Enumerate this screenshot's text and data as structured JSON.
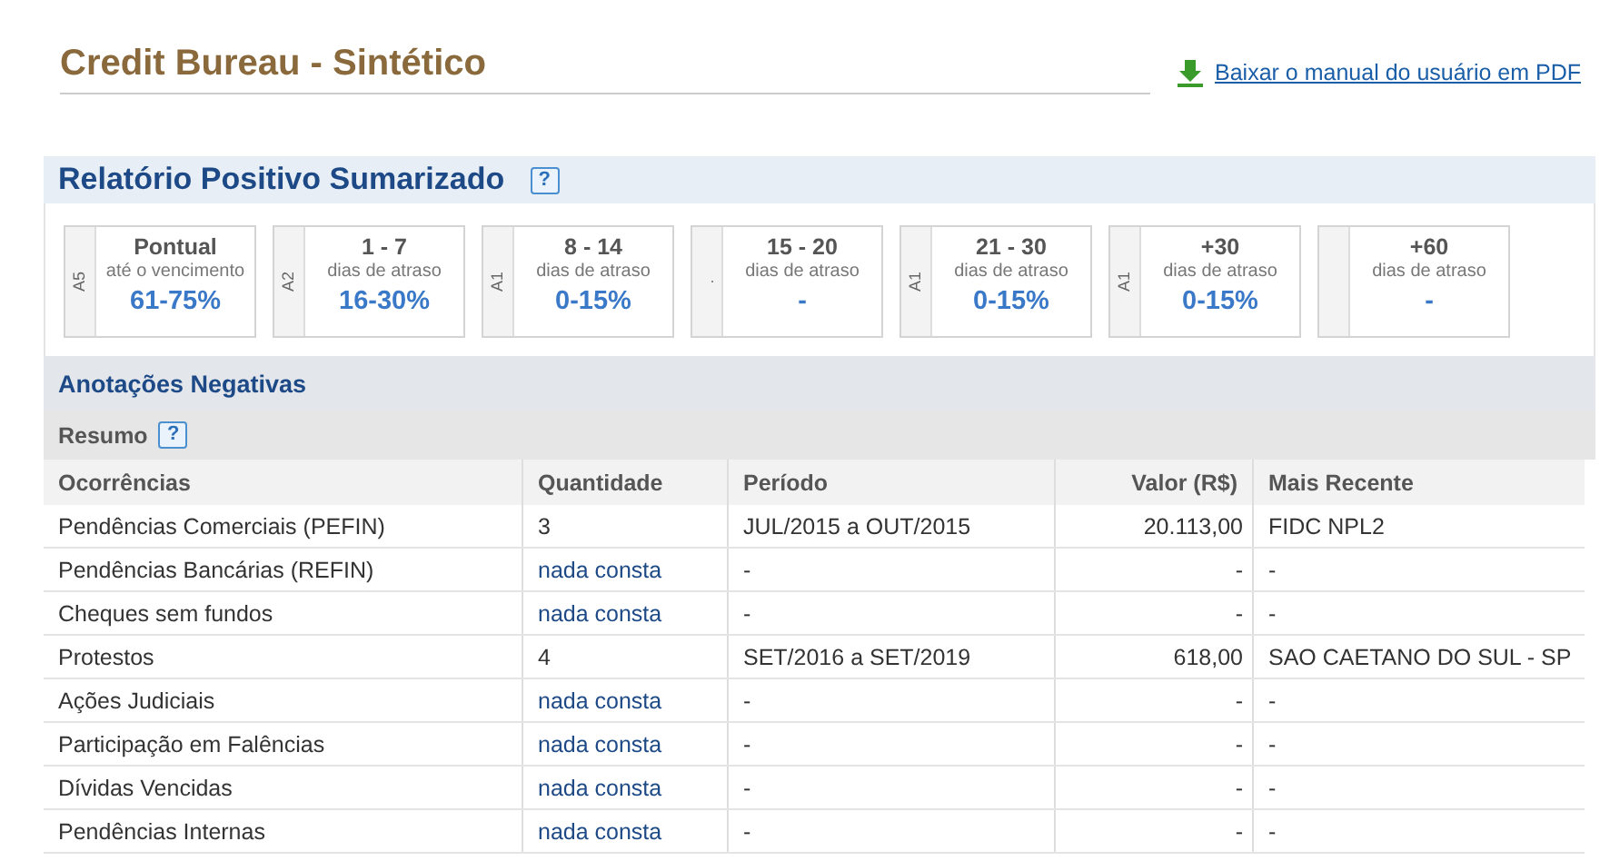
{
  "header": {
    "title": "Credit Bureau - Sintético",
    "manual_link": "Baixar o manual do usuário em PDF"
  },
  "positive_report": {
    "title": "Relatório Positivo Sumarizado",
    "help": "?",
    "cards": [
      {
        "side": "A5",
        "title": "Pontual",
        "subtitle": "até o vencimento",
        "value": "61-75%"
      },
      {
        "side": "A2",
        "title": "1 - 7",
        "subtitle": "dias de atraso",
        "value": "16-30%"
      },
      {
        "side": "A1",
        "title": "8 - 14",
        "subtitle": "dias de atraso",
        "value": "0-15%"
      },
      {
        "side": ".",
        "title": "15 - 20",
        "subtitle": "dias de atraso",
        "value": "-"
      },
      {
        "side": "A1",
        "title": "21 - 30",
        "subtitle": "dias de atraso",
        "value": "0-15%"
      },
      {
        "side": "A1",
        "title": "+30",
        "subtitle": "dias de atraso",
        "value": "0-15%"
      },
      {
        "title": "+60",
        "subtitle": "dias de atraso",
        "value": "-"
      }
    ]
  },
  "negative": {
    "title": "Anotações Negativas",
    "summary_title": "Resumo",
    "help": "?",
    "table": {
      "columns": [
        "Ocorrências",
        "Quantidade",
        "Período",
        "Valor (R$)",
        "Mais Recente"
      ],
      "rows": [
        {
          "kind": "found",
          "cells": [
            "Pendências Comerciais (PEFIN)",
            "3",
            "JUL/2015 a OUT/2015",
            "20.113,00",
            "FIDC NPL2"
          ]
        },
        {
          "kind": "clear",
          "cells": [
            "Pendências Bancárias (REFIN)",
            "nada consta",
            "-",
            "-",
            "-"
          ]
        },
        {
          "kind": "clear",
          "cells": [
            "Cheques sem fundos",
            "nada consta",
            "-",
            "-",
            "-"
          ]
        },
        {
          "kind": "found",
          "cells": [
            "Protestos",
            "4",
            "SET/2016 a SET/2019",
            "618,00",
            "SAO CAETANO DO SUL - SP"
          ]
        },
        {
          "kind": "clear",
          "cells": [
            "Ações Judiciais",
            "nada consta",
            "-",
            "-",
            "-"
          ]
        },
        {
          "kind": "clear",
          "cells": [
            "Participação em Falências",
            "nada consta",
            "-",
            "-",
            "-"
          ]
        },
        {
          "kind": "clear",
          "cells": [
            "Dívidas Vencidas",
            "nada consta",
            "-",
            "-",
            "-"
          ]
        },
        {
          "kind": "clear",
          "cells": [
            "Pendências Internas",
            "nada consta",
            "-",
            "-",
            "-"
          ]
        }
      ]
    }
  }
}
